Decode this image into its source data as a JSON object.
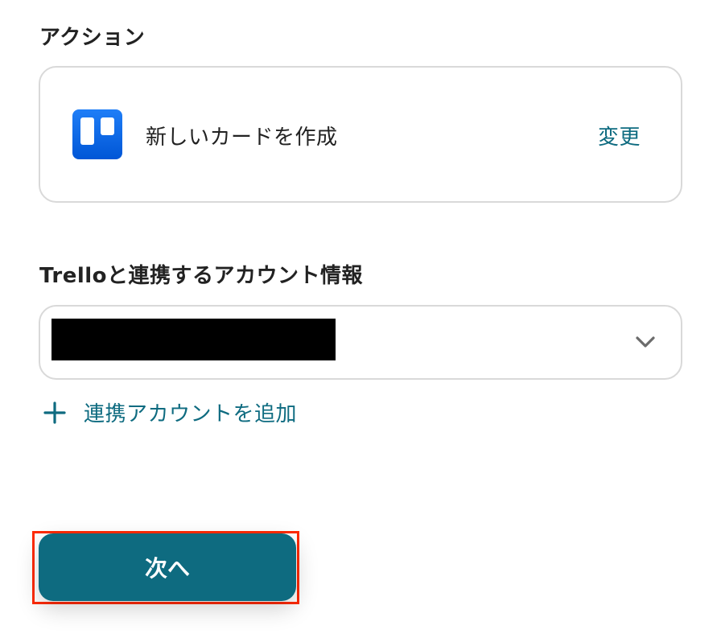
{
  "action_section": {
    "label": "アクション",
    "card": {
      "app_icon": "trello-logo-icon",
      "title": "新しいカードを作成",
      "change_label": "変更"
    }
  },
  "account_section": {
    "label": "Trelloと連携するアカウント情報",
    "select": {
      "value": "",
      "value_redacted": true,
      "dropdown_icon": "chevron-down-icon"
    },
    "add_account_label": "連携アカウントを追加",
    "add_icon": "plus-icon"
  },
  "footer": {
    "next_label": "次へ",
    "highlight_color": "#ff2a00"
  },
  "colors": {
    "accent": "#0e6b80",
    "trello_blue": "#0c66e4",
    "border": "#d9d9d9",
    "text": "#222222"
  }
}
